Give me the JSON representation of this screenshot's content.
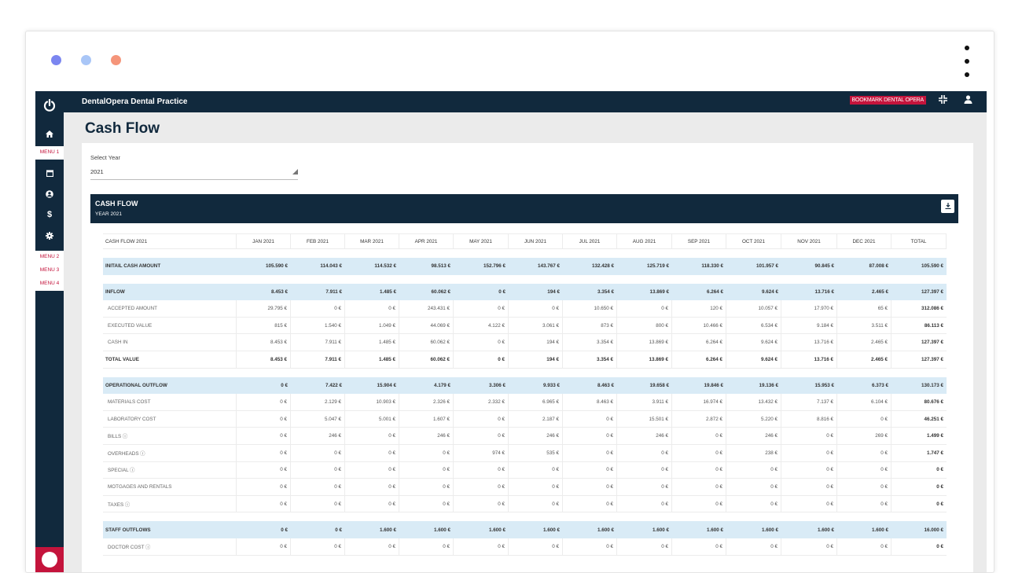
{
  "window": {
    "dot_colors": [
      "#7b86f0",
      "#a9c6f7",
      "#f5957a"
    ]
  },
  "topbar": {
    "title": "DentalOpera Dental Practice",
    "bookmark": "BOOKMARK DENTAL OPERA",
    "fullscreen_icon": "fullscreen-icon",
    "user_icon": "user-icon"
  },
  "sidebar": {
    "icons": [
      "power-icon",
      "home-icon",
      "calendar-icon",
      "user-circle-icon",
      "dollar-icon",
      "gear-icon"
    ],
    "menu1": "MENU 1",
    "menu2": "MENU 2",
    "menu3": "MENU 3",
    "menu4": "MENU 4"
  },
  "page": {
    "title": "Cash Flow"
  },
  "select_year": {
    "label": "Select Year",
    "value": "2021"
  },
  "cashflow_header": {
    "title": "CASH FLOW",
    "subtitle": "YEAR 2021",
    "download_icon": "download-icon"
  },
  "table": {
    "columns": [
      "CASH FLOW 2021",
      "JAN 2021",
      "FEB 2021",
      "MAR 2021",
      "APR 2021",
      "MAY 2021",
      "JUN 2021",
      "JUL 2021",
      "AUG 2021",
      "SEP 2021",
      "OCT 2021",
      "NOV 2021",
      "DEC 2021",
      "TOTAL"
    ],
    "rows": [
      {
        "kind": "section",
        "label": "INITAIL CASH AMOUNT",
        "values": [
          "105.590 €",
          "114.043 €",
          "114.532 €",
          "98.513 €",
          "152.796 €",
          "143.767 €",
          "132.428 €",
          "125.719 €",
          "118.330 €",
          "101.957 €",
          "90.845 €",
          "87.008 €",
          "105.590 €"
        ]
      },
      {
        "kind": "gap"
      },
      {
        "kind": "section",
        "label": "INFLOW",
        "values": [
          "8.453 €",
          "7.911 €",
          "1.485 €",
          "60.062 €",
          "0 €",
          "194 €",
          "3.354 €",
          "13.869 €",
          "6.264 €",
          "9.624 €",
          "13.716 €",
          "2.465 €",
          "127.397 €"
        ]
      },
      {
        "kind": "sub",
        "label": "ACCEPTED AMOUNT",
        "values": [
          "29.795 €",
          "0 €",
          "0 €",
          "243.431 €",
          "0 €",
          "0 €",
          "10.650 €",
          "0 €",
          "120 €",
          "10.057 €",
          "17.970 €",
          "65 €",
          "312.086 €"
        ]
      },
      {
        "kind": "sub",
        "label": "EXECUTED VALUE",
        "values": [
          "815 €",
          "1.540 €",
          "1.049 €",
          "44.069 €",
          "4.122 €",
          "3.061 €",
          "873 €",
          "800 €",
          "10.466 €",
          "6.534 €",
          "9.184 €",
          "3.511 €",
          "86.113 €"
        ]
      },
      {
        "kind": "sub",
        "label": "CASH IN",
        "values": [
          "8.453 €",
          "7.911 €",
          "1.485 €",
          "60.062 €",
          "0 €",
          "194 €",
          "3.354 €",
          "13.869 €",
          "6.264 €",
          "9.624 €",
          "13.716 €",
          "2.465 €",
          "127.397 €"
        ]
      },
      {
        "kind": "total",
        "label": "TOTAL VALUE",
        "values": [
          "8.453 €",
          "7.911 €",
          "1.485 €",
          "60.062 €",
          "0 €",
          "194 €",
          "3.354 €",
          "13.869 €",
          "6.264 €",
          "9.624 €",
          "13.716 €",
          "2.465 €",
          "127.397 €"
        ]
      },
      {
        "kind": "gap"
      },
      {
        "kind": "section",
        "label": "OPERATIONAL OUTFLOW",
        "values": [
          "0 €",
          "7.422 €",
          "15.904 €",
          "4.179 €",
          "3.306 €",
          "9.933 €",
          "8.463 €",
          "19.658 €",
          "19.846 €",
          "19.136 €",
          "15.953 €",
          "6.373 €",
          "130.173 €"
        ]
      },
      {
        "kind": "sub",
        "label": "MATERIALS COST",
        "values": [
          "0 €",
          "2.129 €",
          "10.903 €",
          "2.326 €",
          "2.332 €",
          "6.965 €",
          "8.463 €",
          "3.911 €",
          "16.974 €",
          "13.432 €",
          "7.137 €",
          "6.104 €",
          "80.676 €"
        ]
      },
      {
        "kind": "sub",
        "label": "LABORATORY COST",
        "values": [
          "0 €",
          "5.047 €",
          "5.001 €",
          "1.607 €",
          "0 €",
          "2.187 €",
          "0 €",
          "15.501 €",
          "2.872 €",
          "5.220 €",
          "8.816 €",
          "0 €",
          "46.251 €"
        ]
      },
      {
        "kind": "sub",
        "label": "BILLS ⓘ",
        "values": [
          "0 €",
          "246 €",
          "0 €",
          "246 €",
          "0 €",
          "246 €",
          "0 €",
          "246 €",
          "0 €",
          "246 €",
          "0 €",
          "269 €",
          "1.499 €"
        ]
      },
      {
        "kind": "sub",
        "label": "OVERHEADS ⓘ",
        "values": [
          "0 €",
          "0 €",
          "0 €",
          "0 €",
          "974 €",
          "535 €",
          "0 €",
          "0 €",
          "0 €",
          "238 €",
          "0 €",
          "0 €",
          "1.747 €"
        ]
      },
      {
        "kind": "sub",
        "label": "SPECIAL ⓘ",
        "values": [
          "0 €",
          "0 €",
          "0 €",
          "0 €",
          "0 €",
          "0 €",
          "0 €",
          "0 €",
          "0 €",
          "0 €",
          "0 €",
          "0 €",
          "0 €"
        ]
      },
      {
        "kind": "sub",
        "label": "MOTGAGES AND RENTALS",
        "values": [
          "0 €",
          "0 €",
          "0 €",
          "0 €",
          "0 €",
          "0 €",
          "0 €",
          "0 €",
          "0 €",
          "0 €",
          "0 €",
          "0 €",
          "0 €"
        ]
      },
      {
        "kind": "sub",
        "label": "TAXES ⓘ",
        "values": [
          "0 €",
          "0 €",
          "0 €",
          "0 €",
          "0 €",
          "0 €",
          "0 €",
          "0 €",
          "0 €",
          "0 €",
          "0 €",
          "0 €",
          "0 €"
        ]
      },
      {
        "kind": "gap"
      },
      {
        "kind": "section",
        "label": "STAFF OUTFLOWS",
        "values": [
          "0 €",
          "0 €",
          "1.600 €",
          "1.600 €",
          "1.600 €",
          "1.600 €",
          "1.600 €",
          "1.600 €",
          "1.600 €",
          "1.600 €",
          "1.600 €",
          "1.600 €",
          "16.000 €"
        ]
      },
      {
        "kind": "sub",
        "label": "DOCTOR COST ⓘ",
        "values": [
          "0 €",
          "0 €",
          "0 €",
          "0 €",
          "0 €",
          "0 €",
          "0 €",
          "0 €",
          "0 €",
          "0 €",
          "0 €",
          "0 €",
          "0 €"
        ]
      }
    ]
  }
}
